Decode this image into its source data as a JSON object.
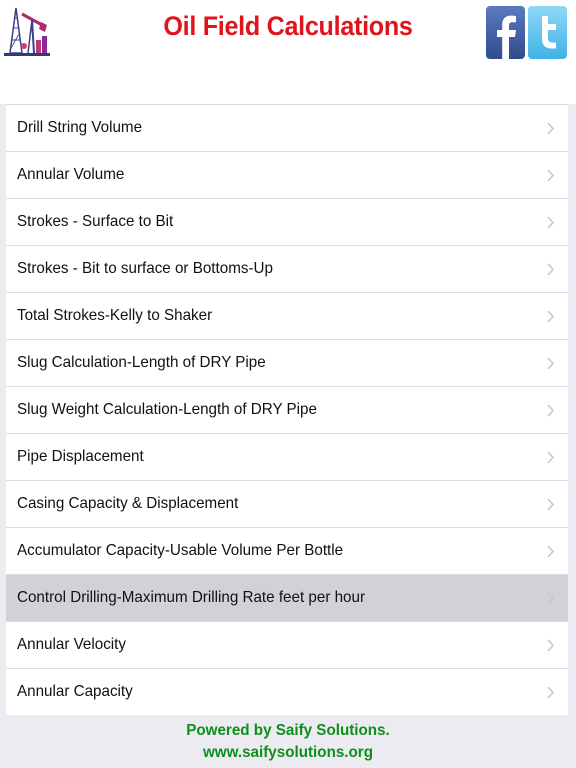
{
  "header": {
    "title": "Oil Field Calculations",
    "title_color": "#e0151c",
    "logo_icon": "oil-pump-jack-icon",
    "facebook_icon": "facebook-icon",
    "twitter_icon": "twitter-icon"
  },
  "menu": {
    "items": [
      {
        "label": "Drill String Volume"
      },
      {
        "label": "Annular Volume"
      },
      {
        "label": "Strokes - Surface to Bit"
      },
      {
        "label": "Strokes - Bit to surface or Bottoms-Up"
      },
      {
        "label": "Total Strokes-Kelly to Shaker"
      },
      {
        "label": "Slug Calculation-Length of DRY Pipe"
      },
      {
        "label": "Slug Weight Calculation-Length of DRY Pipe"
      },
      {
        "label": "Pipe Displacement"
      },
      {
        "label": "Casing Capacity & Displacement"
      },
      {
        "label": "Accumulator Capacity-Usable Volume Per Bottle"
      },
      {
        "label": "Control Drilling-Maximum Drilling Rate feet per hour"
      },
      {
        "label": "Annular Velocity"
      },
      {
        "label": "Annular Capacity"
      }
    ],
    "selected_index": 10,
    "chevron_icon": "chevron-right-icon"
  },
  "footer": {
    "line1": "Powered by Saify Solutions.",
    "line2": "www.saifysolutions.org",
    "color": "#0e8f1b"
  }
}
